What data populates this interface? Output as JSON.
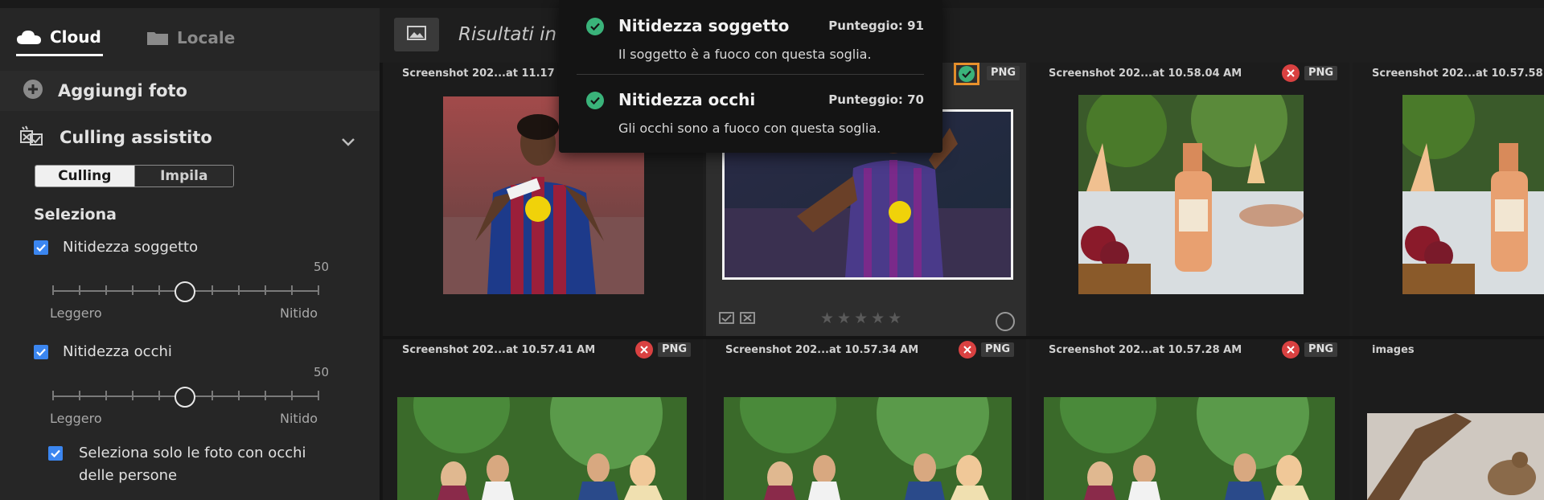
{
  "tabs": {
    "cloud": "Cloud",
    "local": "Locale"
  },
  "add_photo": "Aggiungi foto",
  "culling": {
    "title": "Culling assistito",
    "segment": {
      "culling": "Culling",
      "stack": "Impila"
    },
    "select_title": "Seleziona",
    "subject_sharpness": {
      "label": "Nitidezza soggetto",
      "value": "50",
      "level": 0.5,
      "min_label": "Leggero",
      "max_label": "Nitido",
      "checked": true
    },
    "eye_sharpness": {
      "label": "Nitidezza occhi",
      "value": "50",
      "level": 0.5,
      "min_label": "Leggero",
      "max_label": "Nitido",
      "checked": true
    },
    "eyes_only": {
      "line1": "Seleziona solo le foto con occhi",
      "line2": "delle persone",
      "checked": true
    }
  },
  "results_title": "Risultati in",
  "grid": {
    "cells": [
      {
        "name": "Screenshot 202...at 11.17"
      },
      {
        "name": "",
        "badge": "PNG",
        "status": "accepted",
        "selected": true
      },
      {
        "name": "Screenshot 202...at 10.58.04 AM",
        "badge": "PNG",
        "status": "rejected"
      },
      {
        "name": "Screenshot 202...at 10.57.58"
      },
      {
        "name": "Screenshot 202...at 10.57.41 AM",
        "badge": "PNG",
        "status": "rejected"
      },
      {
        "name": "Screenshot 202...at 10.57.34 AM",
        "badge": "PNG",
        "status": "rejected"
      },
      {
        "name": "Screenshot 202...at 10.57.28 AM",
        "badge": "PNG",
        "status": "rejected"
      },
      {
        "name": "images"
      }
    ],
    "stars": "★★★★★",
    "rating": 0
  },
  "tooltip": {
    "subject": {
      "title": "Nitidezza soggetto",
      "score": "Punteggio: 91",
      "desc": "Il soggetto è a fuoco con questa soglia."
    },
    "eyes": {
      "title": "Nitidezza occhi",
      "score": "Punteggio: 70",
      "desc": "Gli occhi sono a fuoco con questa soglia."
    }
  },
  "colors": {
    "accent_blue": "#3b86f0",
    "reject_red": "#d94141",
    "accept_green": "#3ab37a",
    "selected_orange": "#e8912c"
  }
}
